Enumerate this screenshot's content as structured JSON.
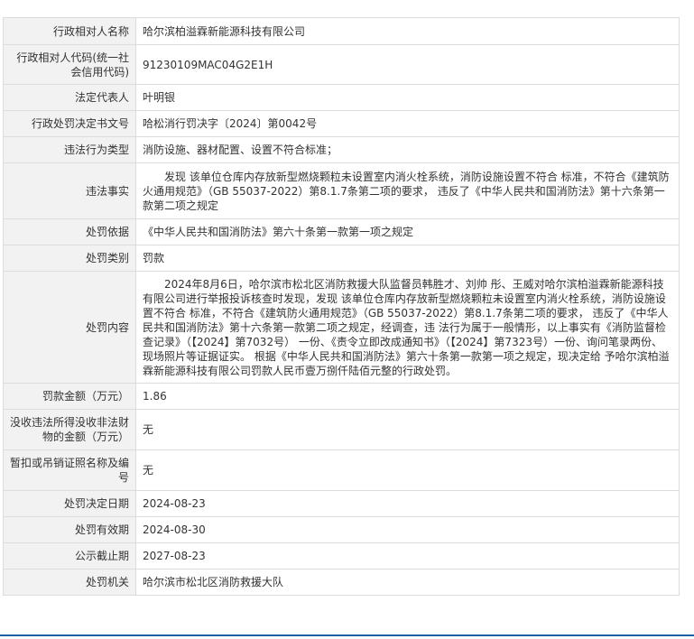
{
  "record": {
    "rows": [
      {
        "label": "行政相对人名称",
        "value": "哈尔滨柏溢霖新能源科技有限公司"
      },
      {
        "label": "行政相对人代码(统一社会信用代码)",
        "value": "91230109MAC04G2E1H"
      },
      {
        "label": "法定代表人",
        "value": "叶明银"
      },
      {
        "label": "行政处罚决定书文号",
        "value": "哈松消行罚决字〔2024〕第0042号"
      },
      {
        "label": "违法行为类型",
        "value": "消防设施、器材配置、设置不符合标准；"
      },
      {
        "label": "违法事实",
        "value": "　　发现 该单位仓库内存放新型燃烧颗粒未设置室内消火栓系统，消防设施设置不符合 标准，不符合《建筑防火通用规范》（GB 55037-2022）第8.1.7条第二项的要求， 违反了《中华人民共和国消防法》第十六条第一款第二项之规定"
      },
      {
        "label": "处罚依据",
        "value": "《中华人民共和国消防法》第六十条第一款第一项之规定"
      },
      {
        "label": "处罚类别",
        "value": "罚款"
      },
      {
        "label": "处罚内容",
        "value": "　　2024年8月6日，哈尔滨市松北区消防救援大队监督员韩胜才、刘帅 彤、王威对哈尔滨柏溢霖新能源科技有限公司进行举报投诉核查时发现，发现 该单位仓库内存放新型燃烧颗粒未设置室内消火栓系统，消防设施设置不符合 标准，不符合《建筑防火通用规范》（GB 55037-2022）第8.1.7条第二项的要求， 违反了《中华人民共和国消防法》第十六条第一款第二项之规定，经调查，违 法行为属于一般情形，以上事实有《消防监督检查记录》（【2024】第7032号） 一份、《责令立即改成通知书》（【2024】第7323号）一份、询问笔录两份、 现场照片等证据证实。 根据《中华人民共和国消防法》第六十条第一款第一项之规定，现决定给 予哈尔滨柏溢霖新能源科技有限公司罚款人民币壹万捌仟陆佰元整的行政处罚。"
      },
      {
        "label": "罚款金额（万元）",
        "value": "1.86"
      },
      {
        "label": "没收违法所得没收非法财物的金额（万元）",
        "value": "无"
      },
      {
        "label": "暂扣或吊销证照名称及编号",
        "value": "无"
      },
      {
        "label": "处罚决定日期",
        "value": "2024-08-23"
      },
      {
        "label": "处罚有效期",
        "value": "2024-08-30"
      },
      {
        "label": "公示截止期",
        "value": "2027-08-23"
      },
      {
        "label": "处罚机关",
        "value": "哈尔滨市松北区消防救援大队"
      }
    ]
  },
  "colors": {
    "label_bg": "#f2f2f2",
    "border": "#dcdcdc",
    "accent_line": "#1f5fa8"
  }
}
